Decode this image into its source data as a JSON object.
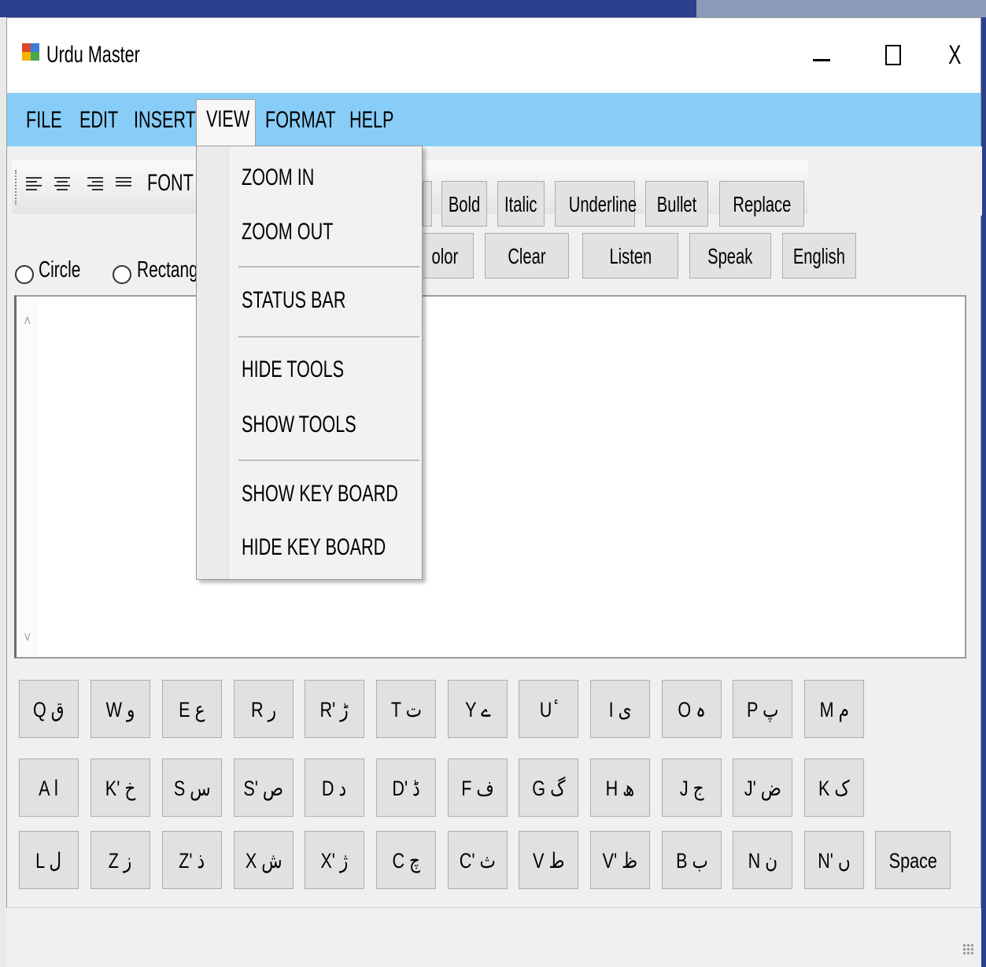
{
  "window": {
    "title": "Urdu Master",
    "minimize": "–",
    "close": "X"
  },
  "menubar": [
    "FILE",
    "EDIT",
    "INSERT",
    "VIEW",
    "FORMAT",
    "HELP"
  ],
  "toolbar": {
    "font_label": "FONT",
    "buttons": [
      "Bold",
      "Italic",
      "Underline",
      "Bullet",
      "Replace"
    ]
  },
  "row2": {
    "radios": [
      "Circle",
      "Rectangle"
    ],
    "partial_button": "olor",
    "buttons": [
      "Clear",
      "Listen",
      "Speak",
      "English"
    ]
  },
  "view_menu": {
    "items": [
      "ZOOM IN",
      "ZOOM OUT",
      "STATUS BAR",
      "HIDE TOOLS",
      "SHOW TOOLS",
      "SHOW KEY BOARD",
      "HIDE KEY BOARD"
    ]
  },
  "keyboard": {
    "row1": [
      "Q ق",
      "W و",
      "E ع",
      "R ر",
      "R' ڑ",
      "T ت",
      "Y ے",
      "U ٔ",
      "I ی",
      "O ہ",
      "P پ",
      "M م"
    ],
    "row2": [
      "A ا",
      "K' خ",
      "S س",
      "S' ص",
      "D د",
      "D' ڈ",
      "F ف",
      "G گ",
      "H ھ",
      "J ج",
      "J' ض",
      "K ک"
    ],
    "row3": [
      "L ل",
      "Z ز",
      "Z' ذ",
      "X ش",
      "X' ژ",
      "C چ",
      "C' ث",
      "V ط",
      "V' ظ",
      "B ب",
      "N ن",
      "N' ں",
      "Space"
    ]
  },
  "colors": {
    "menubar": "#87cdf7",
    "window_bg": "#f0f0f0"
  }
}
